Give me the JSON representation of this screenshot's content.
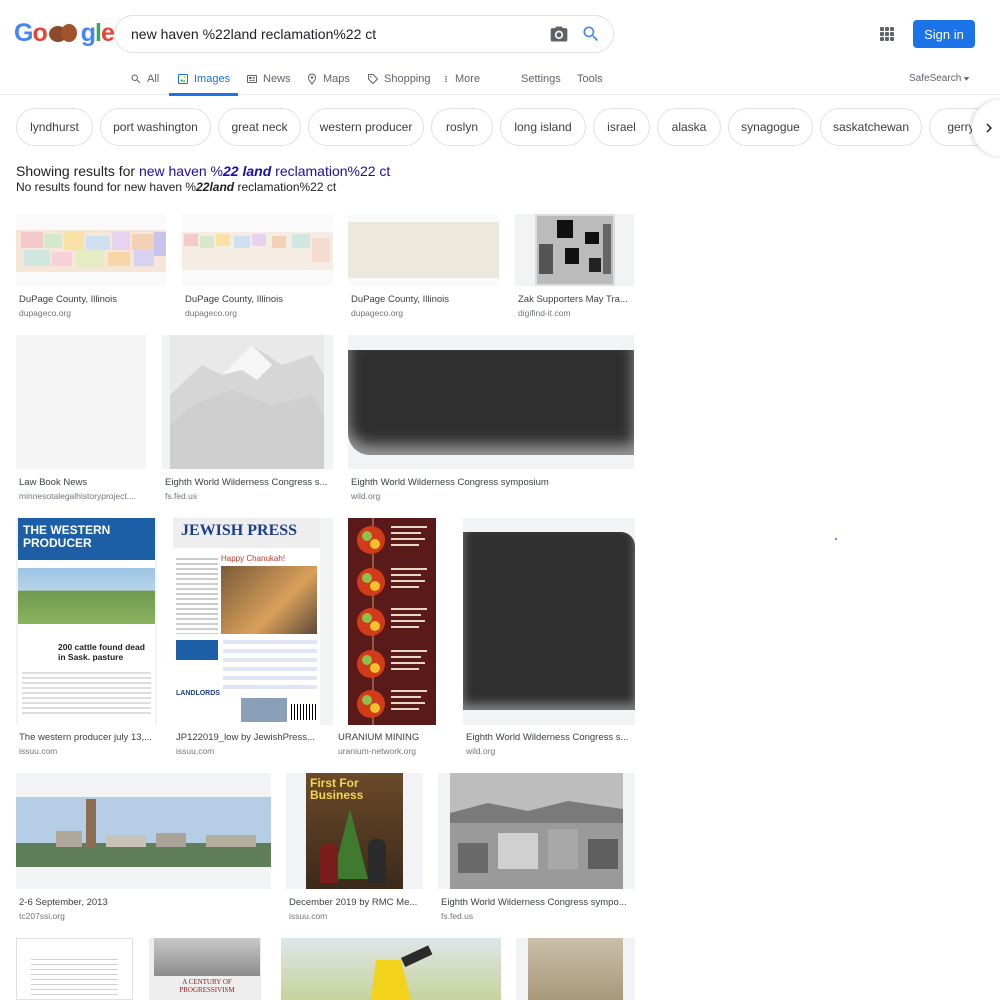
{
  "header": {
    "logo_text": "Google",
    "query": "new haven %22land reclamation%22 ct",
    "sign_in": "Sign in"
  },
  "tabs": [
    {
      "label": "All",
      "icon": "search-icon"
    },
    {
      "label": "Images",
      "icon": "image-icon"
    },
    {
      "label": "News",
      "icon": "news-icon"
    },
    {
      "label": "Maps",
      "icon": "pin-icon"
    },
    {
      "label": "Shopping",
      "icon": "tag-icon"
    },
    {
      "label": "More",
      "icon": "more-vert-icon"
    },
    {
      "label": "Settings"
    },
    {
      "label": "Tools"
    }
  ],
  "safesearch": "SafeSearch",
  "chips": [
    "lyndhurst",
    "port washington",
    "great neck",
    "western producer",
    "roslyn",
    "long island",
    "israel",
    "alaska",
    "synagogue",
    "saskatchewan",
    "gerry"
  ],
  "results_header": {
    "showing_prefix": "Showing results for ",
    "showing_q1": "new haven %",
    "showing_q2": "22 land",
    "showing_q3": " reclamation%22 ct",
    "noresults_prefix": "No results found for new haven %",
    "noresults_q2": "22land",
    "noresults_q3": " reclamation%22 ct"
  },
  "results": [
    {
      "title": "DuPage County, Illinois",
      "source": "dupageco.org"
    },
    {
      "title": "DuPage County, Illinois",
      "source": "dupageco.org"
    },
    {
      "title": "DuPage County, Illinois",
      "source": "dupageco.org"
    },
    {
      "title": "Zak Supporters May Tra...",
      "source": "digifind-it.com"
    },
    {
      "title": "Law Book News",
      "source": "minnesotalegalhistoryproject...."
    },
    {
      "title": "Eighth World Wilderness Congress s...",
      "source": "fs.fed.us"
    },
    {
      "title": "Eighth World Wilderness Congress symposium",
      "source": "wild.org"
    },
    {
      "title": "The western producer july 13,...",
      "source": "issuu.com"
    },
    {
      "title": "JP122019_low by JewishPress...",
      "source": "issuu.com"
    },
    {
      "title": "URANIUM MINING",
      "source": "uranium-network.org"
    },
    {
      "title": "Eighth World Wilderness Congress s...",
      "source": "wild.org"
    },
    {
      "title": "2-6 September, 2013",
      "source": "tc207ssi.org"
    },
    {
      "title": "December 2019 by RMC Me...",
      "source": "issuu.com"
    },
    {
      "title": "Eighth World Wilderness Congress sympo...",
      "source": "fs.fed.us"
    }
  ],
  "thumb_text": {
    "western_producer": "THE WESTERN PRODUCER",
    "western_headline": "200 cattle found dead in Sask. pasture",
    "jewish_press": "JEWISH PRESS",
    "jewish_sub": "Happy Chanukah!",
    "jewish_landlords": "LANDLORDS",
    "first_for_business": "First For Business",
    "progressivism": "A CENTURY OF PROGRESSIVISM"
  },
  "colors": {
    "accent": "#1a73e8",
    "link": "#1a0dab"
  }
}
